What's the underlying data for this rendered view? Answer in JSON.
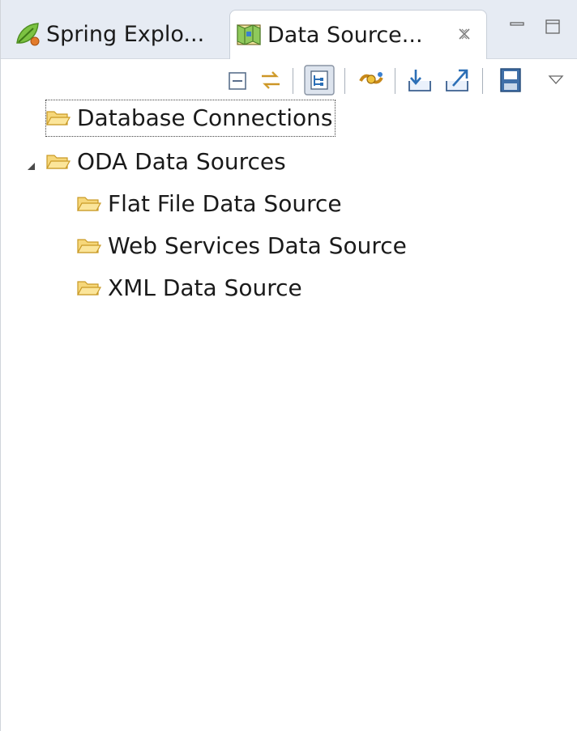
{
  "tabs": [
    {
      "label": "Spring Explo...",
      "icon": "spring-leaf-icon",
      "active": false
    },
    {
      "label": "Data Source...",
      "icon": "data-source-map-icon",
      "active": true,
      "close_glyph": "⨯"
    }
  ],
  "window_controls": {
    "minimize": "minimize-icon",
    "maximize": "maximize-icon"
  },
  "toolbar": {
    "items": [
      "collapse-all-icon",
      "link-with-editor-icon",
      "layout-tree-icon",
      "connect-icon",
      "import-icon",
      "export-icon",
      "save-icon",
      "view-menu-icon"
    ]
  },
  "tree": {
    "nodes": [
      {
        "label": "Database Connections",
        "level": 0,
        "expanded": false,
        "has_children": false,
        "focused": true
      },
      {
        "label": "ODA Data Sources",
        "level": 0,
        "expanded": true,
        "has_children": true,
        "focused": false
      },
      {
        "label": "Flat File Data Source",
        "level": 1,
        "expanded": false,
        "has_children": false,
        "focused": false
      },
      {
        "label": "Web Services Data Source",
        "level": 1,
        "expanded": false,
        "has_children": false,
        "focused": false
      },
      {
        "label": "XML Data Source",
        "level": 1,
        "expanded": false,
        "has_children": false,
        "focused": false
      }
    ]
  },
  "colors": {
    "tabbar_bg": "#e6ebf3",
    "folder_fill": "#f6d77a",
    "folder_stroke": "#c99a26",
    "toolbar_blue": "#2c6fb6"
  }
}
